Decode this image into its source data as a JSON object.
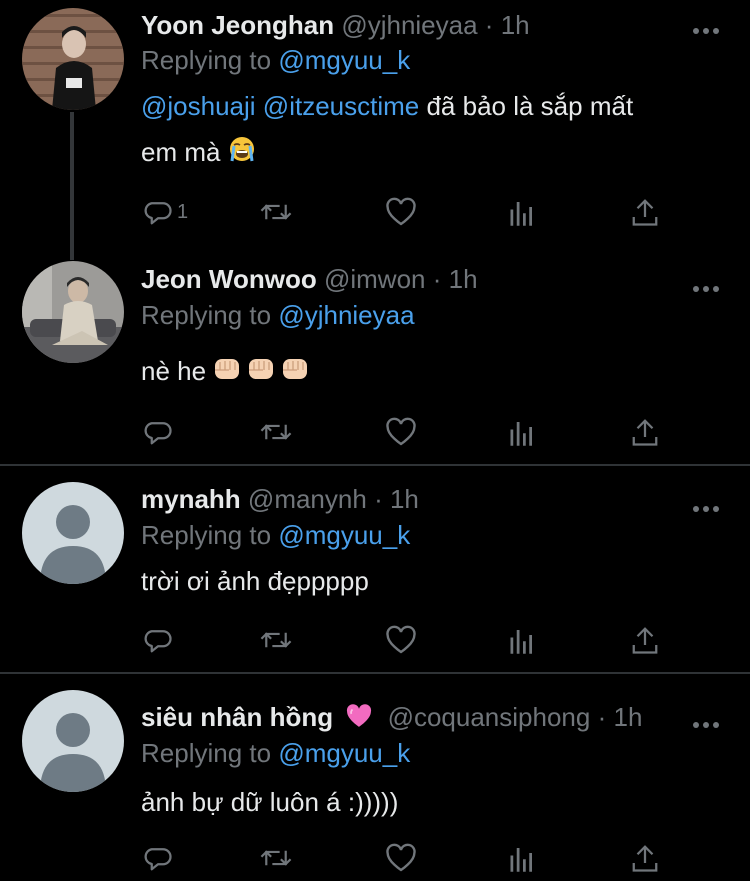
{
  "tweets": [
    {
      "name": "Yoon Jeonghan",
      "handle": "@yjhnieyaa",
      "time": "1h",
      "replying_prefix": "Replying to",
      "replying_to": "@mgyuu_k",
      "mention1": "@joshuaji",
      "mention2": "@itzeusctime",
      "text_after": "đã bảo là sắp mất",
      "text_line2": "em mà",
      "emoji": "loudly-crying-face",
      "reply_count": "1"
    },
    {
      "name": "Jeon Wonwoo",
      "handle": "@imwon",
      "time": "1h",
      "replying_prefix": "Replying to",
      "replying_to": "@yjhnieyaa",
      "text": "nè he",
      "emoji": "oncoming-fist x3"
    },
    {
      "name": "mynahh",
      "handle": "@manynh",
      "time": "1h",
      "replying_prefix": "Replying to",
      "replying_to": "@mgyuu_k",
      "text": "trời ơi ảnh đẹppppp"
    },
    {
      "name": "siêu nhân hồng",
      "name_emoji": "pink-heart",
      "handle": "@coquansiphong",
      "time": "1h",
      "replying_prefix": "Replying to",
      "replying_to": "@mgyuu_k",
      "text": "ảnh bự dữ luôn á :)))))"
    }
  ],
  "ui": {
    "dot": "·",
    "more": "•••"
  },
  "colors": {
    "background": "#000000",
    "text": "#e7e9ea",
    "muted": "#71767b",
    "link": "#4aa0eb",
    "divider": "#2f3336"
  }
}
